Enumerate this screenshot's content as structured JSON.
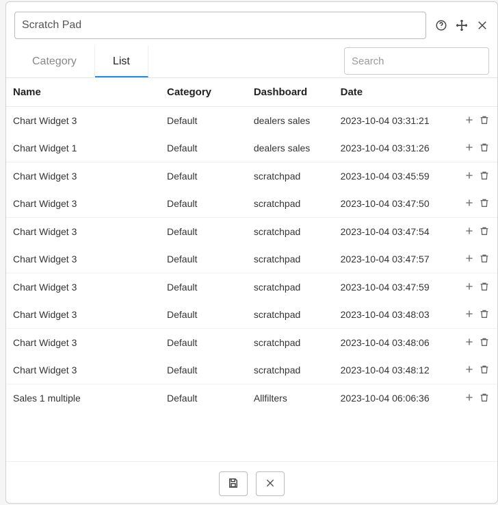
{
  "header": {
    "title_value": "Scratch Pad"
  },
  "tabs": {
    "category": "Category",
    "list": "List"
  },
  "search": {
    "placeholder": "Search"
  },
  "table": {
    "headers": {
      "name": "Name",
      "category": "Category",
      "dashboard": "Dashboard",
      "date": "Date"
    },
    "rows": [
      {
        "name": "Chart Widget 3",
        "category": "Default",
        "dashboard": "dealers sales",
        "date": "2023-10-04 03:31:21"
      },
      {
        "name": "Chart Widget 1",
        "category": "Default",
        "dashboard": "dealers sales",
        "date": "2023-10-04 03:31:26"
      },
      {
        "name": "Chart Widget 3",
        "category": "Default",
        "dashboard": "scratchpad",
        "date": "2023-10-04 03:45:59"
      },
      {
        "name": "Chart Widget 3",
        "category": "Default",
        "dashboard": "scratchpad",
        "date": "2023-10-04 03:47:50"
      },
      {
        "name": "Chart Widget 3",
        "category": "Default",
        "dashboard": "scratchpad",
        "date": "2023-10-04 03:47:54"
      },
      {
        "name": "Chart Widget 3",
        "category": "Default",
        "dashboard": "scratchpad",
        "date": "2023-10-04 03:47:57"
      },
      {
        "name": "Chart Widget 3",
        "category": "Default",
        "dashboard": "scratchpad",
        "date": "2023-10-04 03:47:59"
      },
      {
        "name": "Chart Widget 3",
        "category": "Default",
        "dashboard": "scratchpad",
        "date": "2023-10-04 03:48:03"
      },
      {
        "name": "Chart Widget 3",
        "category": "Default",
        "dashboard": "scratchpad",
        "date": "2023-10-04 03:48:06"
      },
      {
        "name": "Chart Widget 3",
        "category": "Default",
        "dashboard": "scratchpad",
        "date": "2023-10-04 03:48:12"
      },
      {
        "name": "Sales 1 multiple",
        "category": "Default",
        "dashboard": "Allfilters",
        "date": "2023-10-04 06:06:36"
      }
    ]
  }
}
